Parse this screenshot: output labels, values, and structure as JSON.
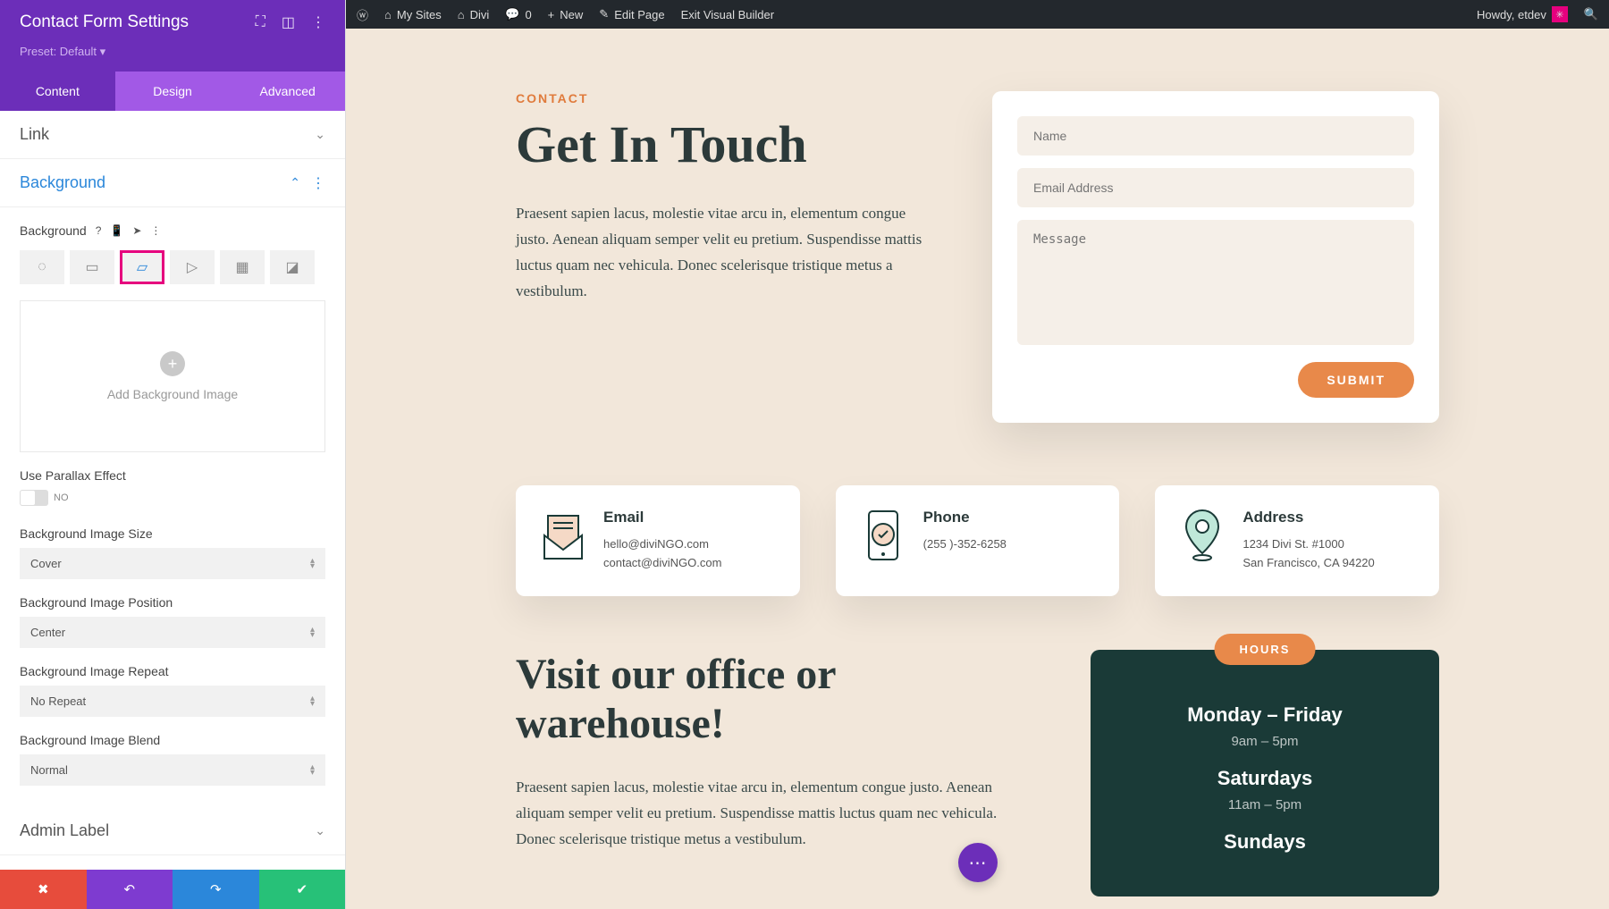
{
  "sidebar": {
    "title": "Contact Form Settings",
    "preset": "Preset: Default ▾",
    "tabs": {
      "content": "Content",
      "design": "Design",
      "advanced": "Advanced"
    },
    "sections": {
      "link": "Link",
      "background": "Background",
      "admin_label": "Admin Label"
    },
    "bg": {
      "label": "Background",
      "add_image": "Add Background Image",
      "parallax_label": "Use Parallax Effect",
      "parallax_value": "NO",
      "size_label": "Background Image Size",
      "size_value": "Cover",
      "position_label": "Background Image Position",
      "position_value": "Center",
      "repeat_label": "Background Image Repeat",
      "repeat_value": "No Repeat",
      "blend_label": "Background Image Blend",
      "blend_value": "Normal"
    }
  },
  "wpbar": {
    "my_sites": "My Sites",
    "site_name": "Divi",
    "comments": "0",
    "new": "New",
    "edit_page": "Edit Page",
    "exit_vb": "Exit Visual Builder",
    "howdy": "Howdy, etdev"
  },
  "page": {
    "eyebrow": "CONTACT",
    "hero_title": "Get In Touch",
    "hero_body": "Praesent sapien lacus, molestie vitae arcu in, elementum congue justo. Aenean aliquam semper velit eu pretium. Suspendisse mattis luctus quam nec vehicula. Donec scelerisque tristique metus a vestibulum.",
    "form": {
      "name_ph": "Name",
      "email_ph": "Email Address",
      "message_ph": "Message",
      "submit": "SUBMIT"
    },
    "cards": [
      {
        "title": "Email",
        "line1": "hello@diviNGO.com",
        "line2": "contact@diviNGO.com"
      },
      {
        "title": "Phone",
        "line1": "(255 )-352-6258",
        "line2": ""
      },
      {
        "title": "Address",
        "line1": "1234 Divi St. #1000",
        "line2": "San Francisco, CA 94220"
      }
    ],
    "visit_title": "Visit our office or warehouse!",
    "visit_body": "Praesent sapien lacus, molestie vitae arcu in, elementum congue justo. Aenean aliquam semper velit eu pretium. Suspendisse mattis luctus quam nec vehicula. Donec scelerisque tristique metus a vestibulum.",
    "hours": {
      "badge": "HOURS",
      "d1": "Monday – Friday",
      "t1": "9am – 5pm",
      "d2": "Saturdays",
      "t2": "11am – 5pm",
      "d3": "Sundays"
    }
  }
}
